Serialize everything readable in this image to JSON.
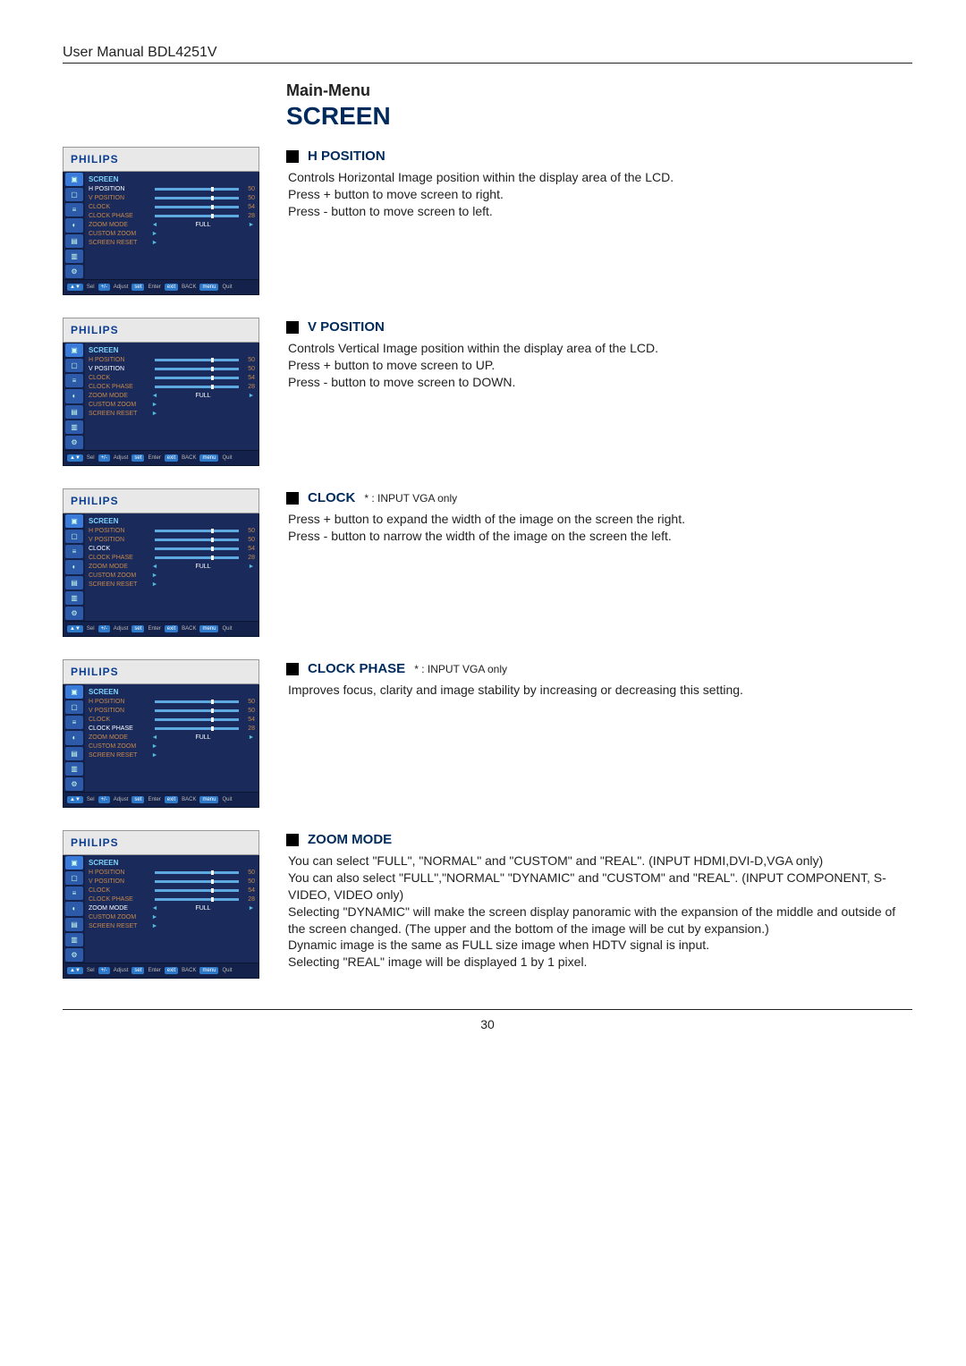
{
  "header": "User Manual BDL4251V",
  "main_menu_label": "Main-Menu",
  "screen_title": "SCREEN",
  "osd_brand": "PHILIPS",
  "osd_menu_title": "SCREEN",
  "osd_items": {
    "h_position": "H POSITION",
    "v_position": "V POSITION",
    "clock": "CLOCK",
    "clock_phase": "CLOCK PHASE",
    "zoom_mode": "ZOOM MODE",
    "custom_zoom": "CUSTOM ZOOM",
    "screen_reset": "SCREEN RESET"
  },
  "osd_values": {
    "v50": "50",
    "v54": "54",
    "v28": "28"
  },
  "osd_full": "FULL",
  "osd_footer": {
    "sel_btn": "▲▼",
    "sel_txt": "Sel",
    "adj_btn": "+/-",
    "adj_txt": "Adjust",
    "enter_btn": "set",
    "enter_txt": "Enter",
    "back_btn": "exit",
    "back_txt": "BACK",
    "quit_btn": "menu",
    "quit_txt": "Quit"
  },
  "sections": {
    "h_position": {
      "heading": "H POSITION",
      "body": "Controls Horizontal Image position within the display area of the LCD.\nPress + button to move screen to right.\nPress - button to move screen to left."
    },
    "v_position": {
      "heading": "V POSITION",
      "body": "Controls Vertical Image position within the display area of the LCD.\nPress + button to move screen to UP.\nPress - button to move screen to DOWN."
    },
    "clock": {
      "heading": "CLOCK",
      "note": "* : INPUT VGA only",
      "body": "Press + button to expand the width of the image on the screen the right.\nPress - button to narrow the width of the image on the screen the left."
    },
    "clock_phase": {
      "heading": "CLOCK PHASE",
      "note": "* : INPUT VGA only",
      "body": "Improves focus, clarity and image stability by increasing or decreasing this setting."
    },
    "zoom_mode": {
      "heading": "ZOOM MODE",
      "body": "You can select \"FULL\", \"NORMAL\" and \"CUSTOM\" and \"REAL\". (INPUT HDMI,DVI-D,VGA only)\nYou can also select \"FULL\",\"NORMAL\" \"DYNAMIC\" and \"CUSTOM\" and \"REAL\". (INPUT COMPONENT, S-VIDEO, VIDEO only)\nSelecting \"DYNAMIC\" will make the screen display panoramic with the expansion of the middle and outside of the screen changed. (The upper and the bottom of the image will be cut by expansion.)\nDynamic image is the same as FULL size image when HDTV signal is input.\nSelecting \"REAL\" image will be displayed 1 by 1 pixel."
    }
  },
  "page_number": "30"
}
